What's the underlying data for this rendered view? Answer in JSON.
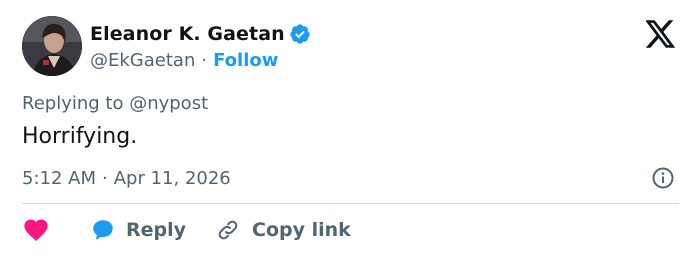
{
  "author": {
    "display_name": "Eleanor K. Gaetan",
    "handle": "@EkGaetan",
    "separator": "·",
    "follow_label": "Follow",
    "verified": true
  },
  "tweet": {
    "replying_to": "Replying to @nypost",
    "text": "Horrifying.",
    "time": "5:12 AM",
    "separator": "·",
    "date": "Apr 11, 2026"
  },
  "actions": {
    "reply_label": "Reply",
    "copy_link_label": "Copy link"
  },
  "icons": {
    "brand": "x-logo-icon",
    "verified": "verified-badge-icon",
    "info": "info-icon",
    "like": "heart-icon",
    "reply": "speech-bubble-icon",
    "copy": "link-icon"
  },
  "colors": {
    "text": "#0f1419",
    "secondary": "#536471",
    "accent": "#1d9bf0",
    "like": "#f91880",
    "divider": "#cfd9de"
  }
}
